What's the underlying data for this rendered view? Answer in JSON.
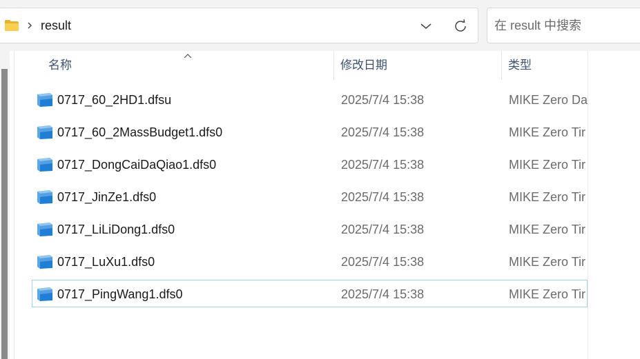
{
  "address": {
    "breadcrumb": "result",
    "separator_icon": "chevron-right-icon",
    "folder_icon": "folder-icon",
    "history_icon": "chevron-down-icon",
    "refresh_icon": "refresh-icon"
  },
  "search": {
    "placeholder": "在 result 中搜索"
  },
  "columns": {
    "name": "名称",
    "date": "修改日期",
    "type": "类型"
  },
  "files": [
    {
      "name": "0717_60_2HD1.dfsu",
      "date": "2025/7/4 15:38",
      "type": "MIKE Zero Da"
    },
    {
      "name": "0717_60_2MassBudget1.dfs0",
      "date": "2025/7/4 15:38",
      "type": "MIKE Zero Tir"
    },
    {
      "name": "0717_DongCaiDaQiao1.dfs0",
      "date": "2025/7/4 15:38",
      "type": "MIKE Zero Tir"
    },
    {
      "name": "0717_JinZe1.dfs0",
      "date": "2025/7/4 15:38",
      "type": "MIKE Zero Tir"
    },
    {
      "name": "0717_LiLiDong1.dfs0",
      "date": "2025/7/4 15:38",
      "type": "MIKE Zero Tir"
    },
    {
      "name": "0717_LuXu1.dfs0",
      "date": "2025/7/4 15:38",
      "type": "MIKE Zero Tir"
    },
    {
      "name": "0717_PingWang1.dfs0",
      "date": "2025/7/4 15:38",
      "type": "MIKE Zero Tir"
    }
  ],
  "colors": {
    "header_text": "#3c5170",
    "secondary_text": "#6b6b6b",
    "focus_border": "#9fd6e0",
    "file_icon_blue": "#1f7fd6",
    "folder_yellow": "#f5c842"
  }
}
